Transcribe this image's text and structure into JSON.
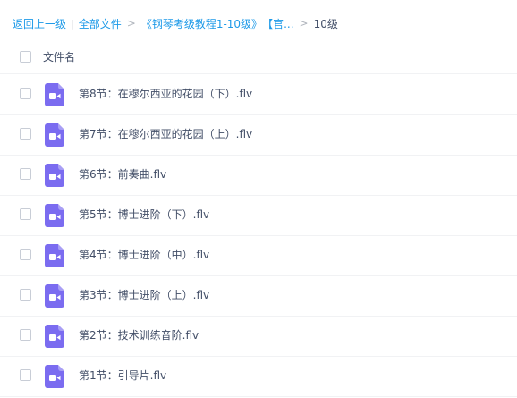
{
  "breadcrumb": {
    "back": "返回上一级",
    "all_files": "全部文件",
    "folder_1": "《钢琴考级教程1-10级》",
    "folder_2": "【官...",
    "current": "10级"
  },
  "table": {
    "column_name": "文件名"
  },
  "files": [
    {
      "name": "第8节：在穆尔西亚的花园（下）.flv",
      "icon": "video-file-icon"
    },
    {
      "name": "第7节：在穆尔西亚的花园（上）.flv",
      "icon": "video-file-icon"
    },
    {
      "name": "第6节：前奏曲.flv",
      "icon": "video-file-icon"
    },
    {
      "name": "第5节：博士进阶（下）.flv",
      "icon": "video-file-icon"
    },
    {
      "name": "第4节：博士进阶（中）.flv",
      "icon": "video-file-icon"
    },
    {
      "name": "第3节：博士进阶（上）.flv",
      "icon": "video-file-icon"
    },
    {
      "name": "第2节：技术训练音阶.flv",
      "icon": "video-file-icon"
    },
    {
      "name": "第1节：引导片.flv",
      "icon": "video-file-icon"
    }
  ],
  "colors": {
    "link": "#1e9ae8",
    "text": "#424e67",
    "icon": "#7b6cf0"
  }
}
